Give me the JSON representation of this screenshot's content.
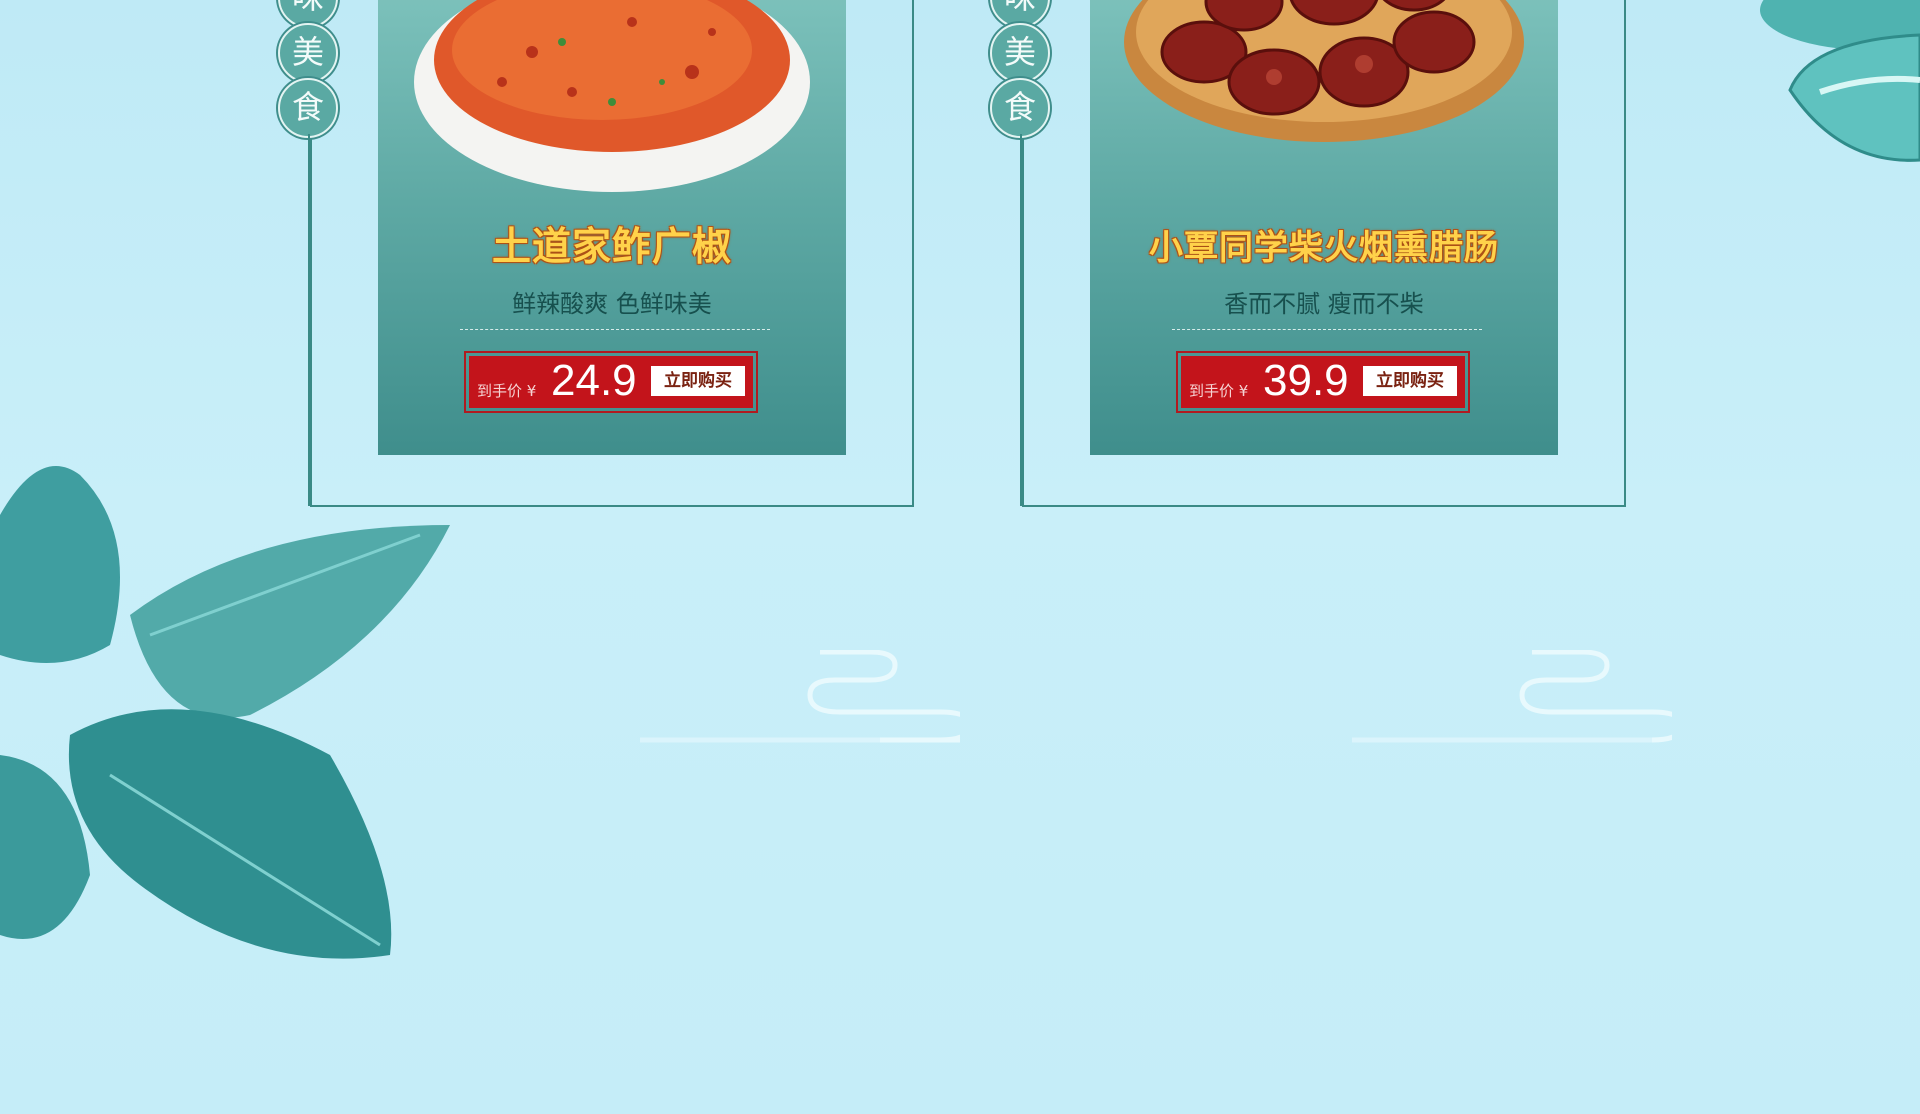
{
  "products": [
    {
      "name": "土道家鲊广椒",
      "slogan": "鲜辣酸爽  色鲜味美",
      "price_prefix": "到手价 ¥",
      "price": "24.9",
      "buy_label": "立即购买",
      "seal_chars": [
        "味",
        "美",
        "食"
      ]
    },
    {
      "name": "小覃同学柴火烟熏腊肠",
      "slogan": "香而不腻  瘦而不柴",
      "price_prefix": "到手价 ¥",
      "price": "39.9",
      "buy_label": "立即购买",
      "seal_chars": [
        "味",
        "美",
        "食"
      ]
    }
  ],
  "colors": {
    "background": "#c5edf8",
    "panel_teal": "#5ea9a4",
    "title_gold": "#ffd24a",
    "price_red": "#c3141b"
  }
}
